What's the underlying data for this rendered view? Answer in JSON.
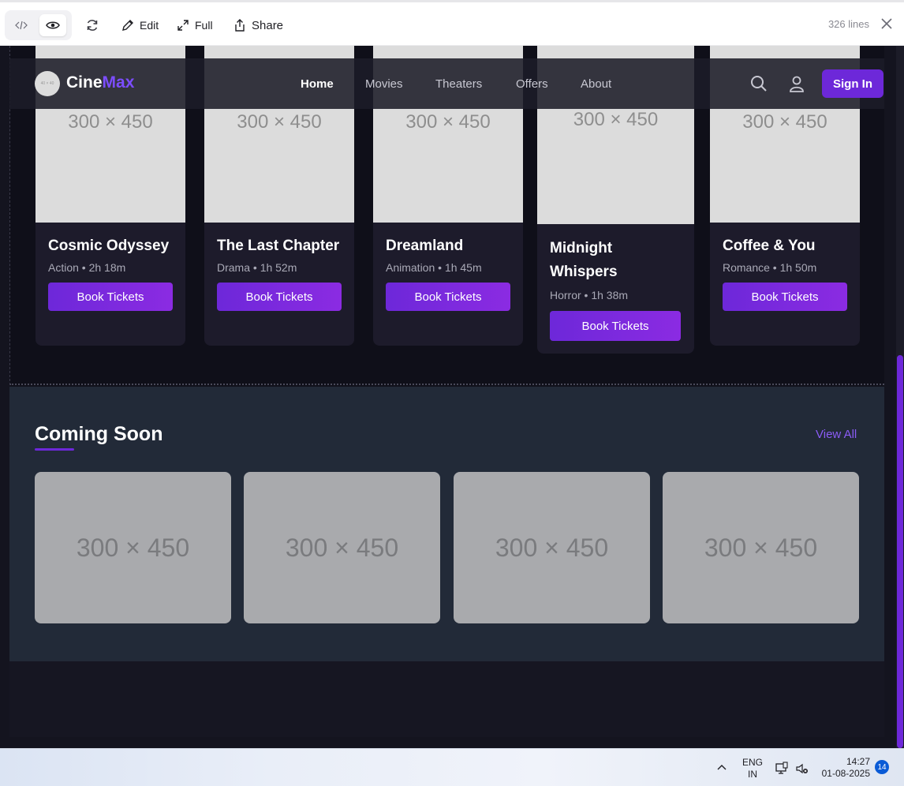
{
  "toolbar": {
    "edit_label": "Edit",
    "full_label": "Full",
    "share_label": "Share",
    "lines_count": "326 lines"
  },
  "nav": {
    "logo_badge": "40 × 40",
    "logo_main": "Cine",
    "logo_accent": "Max",
    "links": [
      "Home",
      "Movies",
      "Theaters",
      "Offers",
      "About"
    ],
    "active_link": "Home",
    "signin_label": "Sign In"
  },
  "now_showing": {
    "poster_placeholder": "300 × 450",
    "cards": [
      {
        "title": "Cosmic Odyssey",
        "meta": "Action • 2h 18m",
        "button": "Book Tickets"
      },
      {
        "title": "The Last Chapter",
        "meta": "Drama • 1h 52m",
        "button": "Book Tickets"
      },
      {
        "title": "Dreamland",
        "meta": "Animation • 1h 45m",
        "button": "Book Tickets"
      },
      {
        "title": "Midnight Whispers",
        "meta": "Horror • 1h 38m",
        "button": "Book Tickets"
      },
      {
        "title": "Coffee & You",
        "meta": "Romance • 1h 50m",
        "button": "Book Tickets"
      }
    ]
  },
  "coming_soon": {
    "title": "Coming Soon",
    "view_all": "View All",
    "placeholder": "300 × 450"
  },
  "taskbar": {
    "lang_line1": "ENG",
    "lang_line2": "IN",
    "time": "14:27",
    "date": "01-08-2025",
    "notification_count": "14"
  },
  "colors": {
    "accent": "#6d28d9",
    "accent_light": "#8b5cf6",
    "page_bg": "#11111b",
    "card_bg": "#1d1b2b"
  }
}
